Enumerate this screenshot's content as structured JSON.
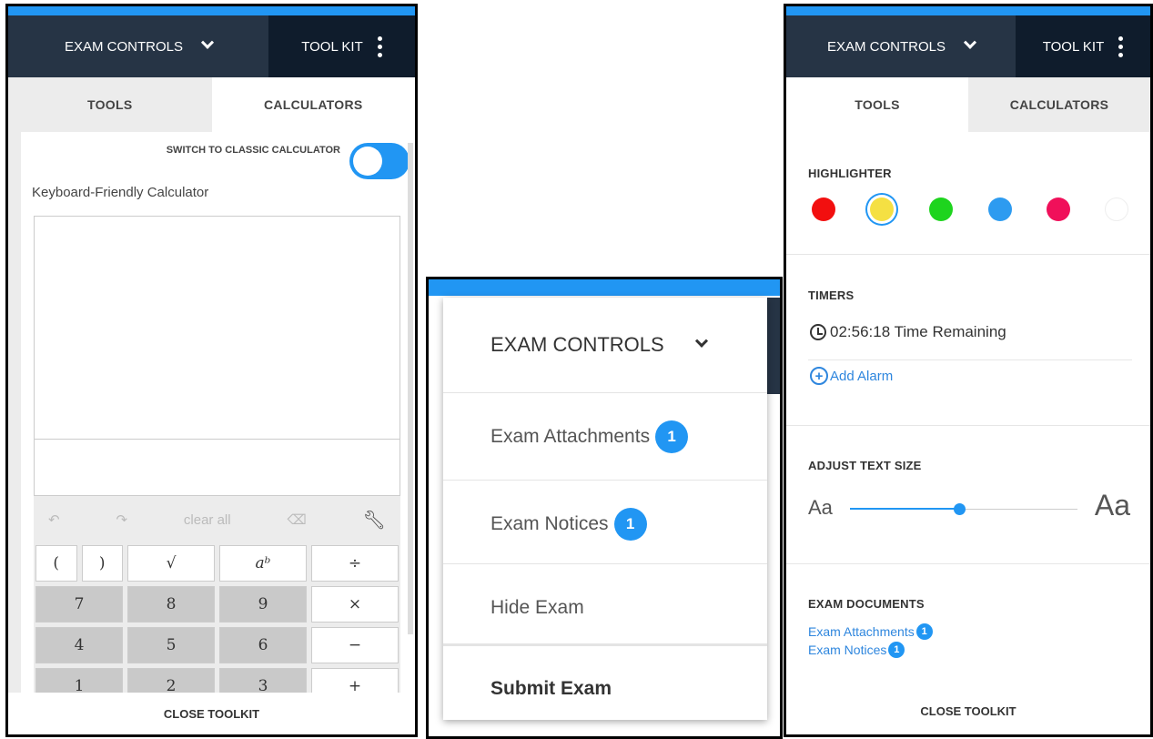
{
  "header": {
    "exam_controls": "EXAM CONTROLS",
    "tool_kit": "TOOL KIT"
  },
  "tabs": {
    "tools": "TOOLS",
    "calculators": "CALCULATORS"
  },
  "calculator_panel": {
    "switch_label": "SWITCH TO CLASSIC CALCULATOR",
    "title": "Keyboard-Friendly Calculator",
    "toolbar": {
      "clear_all": "clear all"
    },
    "keys": {
      "open_paren": "(",
      "close_paren": ")",
      "sqrt": "√",
      "power": "aᵇ",
      "divide": "÷",
      "k7": "7",
      "k8": "8",
      "k9": "9",
      "multiply": "×",
      "k4": "4",
      "k5": "5",
      "k6": "6",
      "minus": "−",
      "k1": "1",
      "k2": "2",
      "k3": "3",
      "plus": "+"
    },
    "close": "CLOSE TOOLKIT"
  },
  "menu_panel": {
    "title": "EXAM CONTROLS",
    "items": {
      "attachments": "Exam Attachments",
      "attachments_count": "1",
      "notices": "Exam Notices",
      "notices_count": "1",
      "hide": "Hide Exam",
      "submit": "Submit Exam"
    }
  },
  "tools_panel": {
    "highlighter": {
      "title": "HIGHLIGHTER",
      "colors": [
        "#f20f0f",
        "#f5e043",
        "#1ed41e",
        "#2d9bf0",
        "#f0105a",
        "#ffffff"
      ],
      "selected": "#f5e043"
    },
    "timers": {
      "title": "TIMERS",
      "remaining": "02:56:18 Time Remaining",
      "add_alarm": "Add Alarm"
    },
    "text_size": {
      "title": "ADJUST TEXT SIZE",
      "small": "Aa",
      "large": "Aa",
      "level": 0.48
    },
    "documents": {
      "title": "EXAM DOCUMENTS",
      "attachments": "Exam Attachments",
      "attachments_count": "1",
      "notices": "Exam Notices",
      "notices_count": "1"
    },
    "close": "CLOSE TOOLKIT"
  }
}
